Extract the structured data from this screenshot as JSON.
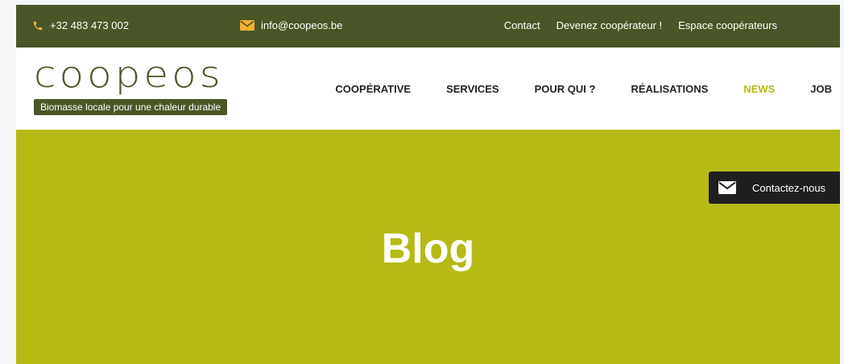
{
  "topbar": {
    "phone": "+32 483 473 002",
    "email": "info@coopeos.be",
    "links": [
      "Contact",
      "Devenez coopérateur !",
      "Espace coopérateurs"
    ]
  },
  "logo": {
    "wordmark": "coopeos",
    "tagline": "Biomasse locale pour une chaleur durable"
  },
  "nav": {
    "items": [
      "COOPÉRATIVE",
      "SERVICES",
      "POUR QUI ?",
      "RÉALISATIONS",
      "NEWS",
      "JOB"
    ],
    "active": "NEWS"
  },
  "hero": {
    "title": "Blog"
  },
  "contact_widget": {
    "label": "Contactez-nous"
  },
  "colors": {
    "brand_dark": "#4a5628",
    "brand_accent": "#b6ba15",
    "icon_accent": "#f2b233"
  }
}
